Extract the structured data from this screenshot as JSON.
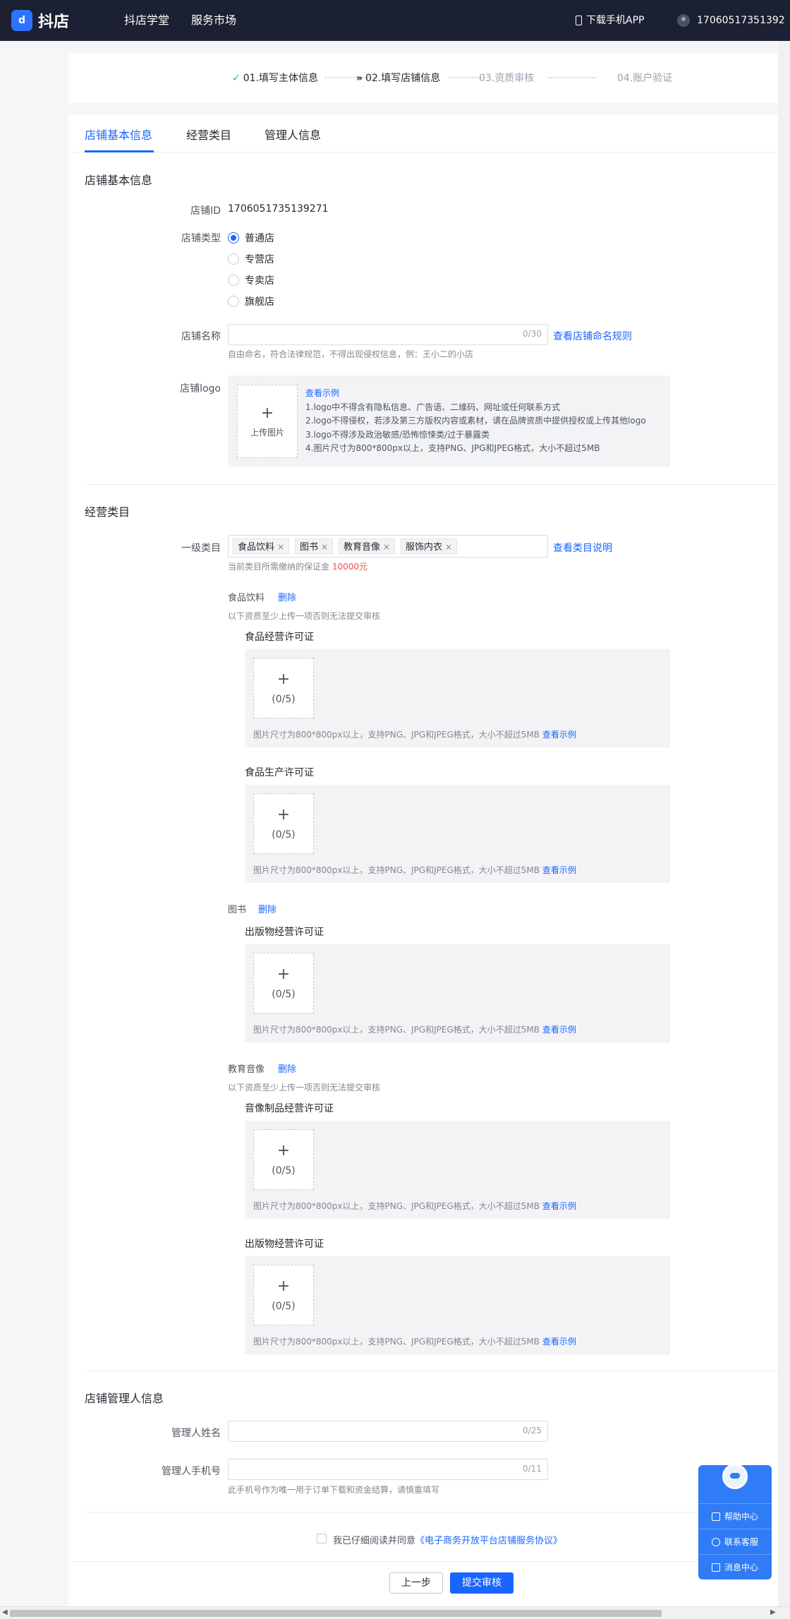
{
  "topbar": {
    "logo_mark": "d",
    "logo_text": "抖店",
    "nav": [
      "抖店学堂",
      "服务市场"
    ],
    "download_app": "下载手机APP",
    "user_id": "17060517351392"
  },
  "steps": [
    {
      "label": "01.填写主体信息",
      "state": "done"
    },
    {
      "label": "02.填写店铺信息",
      "state": "active"
    },
    {
      "label": "03.资质审核",
      "state": "todo"
    },
    {
      "label": "04.账户验证",
      "state": "todo"
    }
  ],
  "tabs": [
    "店铺基本信息",
    "经营类目",
    "管理人信息"
  ],
  "basic": {
    "section_title": "店铺基本信息",
    "shop_id_label": "店铺ID",
    "shop_id_value": "1706051735139271",
    "shop_type_label": "店铺类型",
    "shop_types": [
      {
        "label": "普通店",
        "checked": true
      },
      {
        "label": "专营店",
        "checked": false
      },
      {
        "label": "专卖店",
        "checked": false
      },
      {
        "label": "旗舰店",
        "checked": false
      }
    ],
    "shop_name_label": "店铺名称",
    "shop_name_value": "",
    "shop_name_counter": "0/30",
    "shop_name_rule_link": "查看店铺命名规则",
    "shop_name_hint": "自由命名，符合法律规范，不得出现侵权信息，例：王小二的小店",
    "logo_label": "店铺logo",
    "logo_upload_text": "上传图片",
    "logo_example_link": "查看示例",
    "logo_rules": [
      "1.logo中不得含有隐私信息、广告语、二维码、网址或任何联系方式",
      "2.logo不得侵权，若涉及第三方版权内容或素材，请在品牌资质中提供授权或上传其他logo",
      "3.logo不得涉及政治敏感/恐怖惊悚类/过于暴露类",
      "4.图片尺寸为800*800px以上，支持PNG、JPG和JPEG格式，大小不超过5MB"
    ]
  },
  "category": {
    "section_title": "经营类目",
    "level1_label": "一级类目",
    "tags": [
      "食品饮料",
      "图书",
      "教育音像",
      "服饰内衣"
    ],
    "tag_close": "×",
    "explain_link": "查看类目说明",
    "deposit_hint_prefix": "当前类目所需缴纳的保证金 ",
    "deposit_amount": "10000元",
    "delete_label": "删除",
    "must_upload_hint": "以下资质至少上传一项否则无法提交审核",
    "upload_plus": "+",
    "upload_count": "(0/5)",
    "license_hint": "图片尺寸为800*800px以上，支持PNG、JPG和JPEG格式，大小不超过5MB",
    "example_link": "查看示例",
    "groups": [
      {
        "name": "食品饮料",
        "licenses": [
          "食品经营许可证",
          "食品生产许可证"
        ]
      },
      {
        "name": "图书",
        "licenses": [
          "出版物经营许可证"
        ]
      },
      {
        "name": "教育音像",
        "licenses": [
          "音像制品经营许可证",
          "出版物经营许可证"
        ]
      }
    ]
  },
  "manager": {
    "section_title": "店铺管理人信息",
    "name_label": "管理人姓名",
    "name_counter": "0/25",
    "phone_label": "管理人手机号",
    "phone_counter": "0/11",
    "phone_hint": "此手机号作为唯一用于订单下载和资金结算，请慎重填写"
  },
  "agreement": {
    "prefix": "我已仔细阅读并同意",
    "link": "《电子商务开放平台店铺服务协议》"
  },
  "buttons": {
    "prev": "上一步",
    "submit": "提交审核"
  },
  "help": [
    "帮助中心",
    "联系客服",
    "消息中心"
  ],
  "colors": {
    "primary": "#1966ff",
    "topbar": "#1b2033",
    "help_panel": "#2f7cf6",
    "deposit": "#f54a45"
  }
}
